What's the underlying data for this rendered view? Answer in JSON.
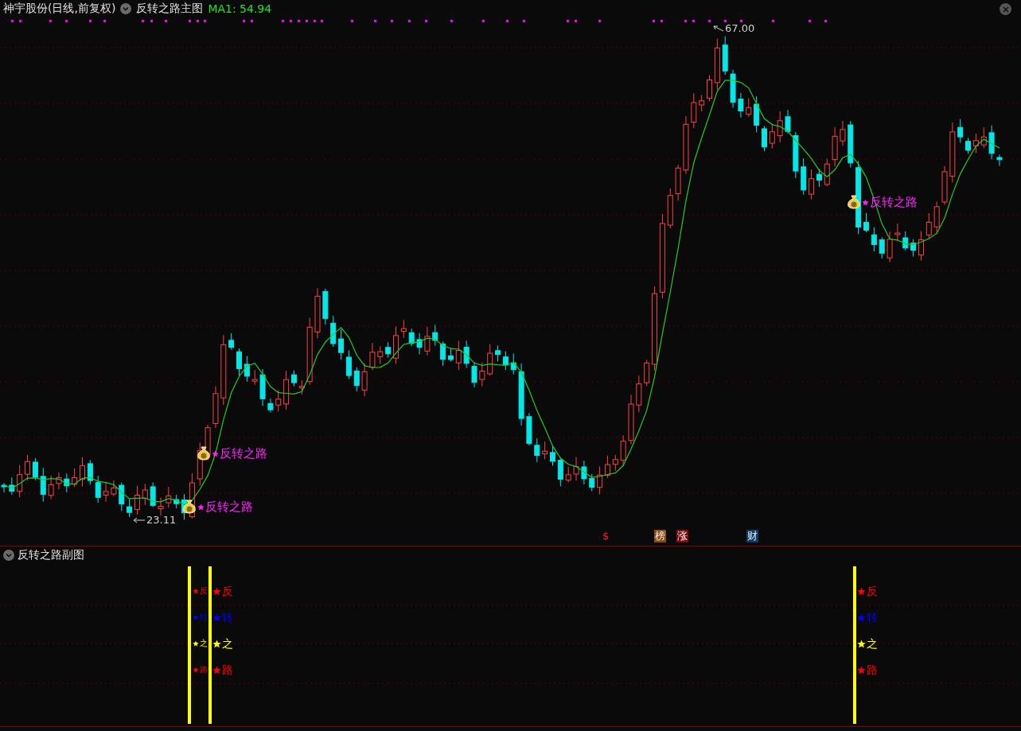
{
  "header": {
    "stock": "神宇股份(日线,前复权)",
    "indicator": "反转之路主图",
    "ma_label": "MA1: 54.94"
  },
  "main_chart": {
    "high_label": "67.00",
    "low_label": "23.11",
    "signals": [
      {
        "text": "反转之路"
      },
      {
        "text": "反转之路"
      },
      {
        "text": "反转之路"
      }
    ],
    "event_tags": [
      {
        "text": "$",
        "color": "#0a0a0a"
      },
      {
        "text": "榜",
        "color": "#8b4a10"
      },
      {
        "text": "涨",
        "color": "#7a0c0c"
      },
      {
        "text": "财",
        "color": "#0e3a6a"
      }
    ]
  },
  "sub_chart": {
    "title": "反转之路副图",
    "columns": [
      {
        "marks": [
          {
            "text": "反",
            "color": "#ff0000"
          },
          {
            "text": "转",
            "color": "#0000ff"
          },
          {
            "text": "之",
            "color": "#ffff00"
          },
          {
            "text": "路",
            "color": "#ff0000"
          }
        ]
      },
      {
        "marks": [
          {
            "text": "反",
            "color": "#ff0000"
          },
          {
            "text": "转",
            "color": "#0000ff"
          },
          {
            "text": "之",
            "color": "#ffff00"
          },
          {
            "text": "路",
            "color": "#ff0000"
          }
        ]
      },
      {
        "marks": [
          {
            "text": "反",
            "color": "#ff0000"
          },
          {
            "text": "转",
            "color": "#0000ff"
          },
          {
            "text": "之",
            "color": "#ffff00"
          },
          {
            "text": "路",
            "color": "#ff0000"
          }
        ]
      }
    ]
  }
}
